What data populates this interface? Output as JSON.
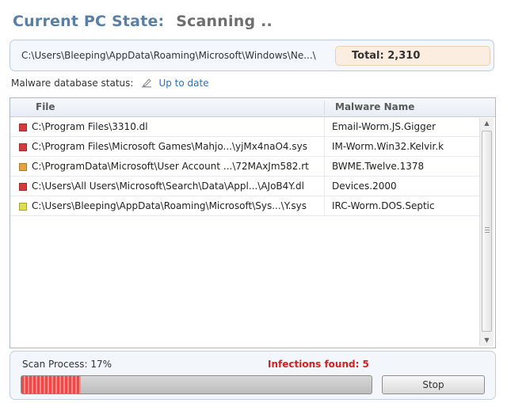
{
  "header": {
    "label": "Current PC State:",
    "state": "Scanning .."
  },
  "scan_path": {
    "current": "C:\\Users\\Bleeping\\AppData\\Roaming\\Microsoft\\Windows\\Ne...\\",
    "total": "Total: 2,310"
  },
  "database": {
    "label": "Malware database status:",
    "status": "Up to date",
    "icon": "edit-pencil-icon"
  },
  "table": {
    "columns": [
      "File",
      "Malware Name"
    ],
    "rows": [
      {
        "file": "C:\\Program Files\\3310.dl",
        "malware": "Email-Worm.JS.Gigger",
        "color": "#d63a3a"
      },
      {
        "file": "C:\\Program Files\\Microsoft Games\\Mahjo...\\yjMx4naO4.sys",
        "malware": "IM-Worm.Win32.Kelvir.k",
        "color": "#d63a3a"
      },
      {
        "file": "C:\\ProgramData\\Microsoft\\User Account ...\\72MAxJm582.rt",
        "malware": "BWME.Twelve.1378",
        "color": "#e8a23c"
      },
      {
        "file": "C:\\Users\\All Users\\Microsoft\\Search\\Data\\Appl...\\AJoB4Y.dl",
        "malware": "Devices.2000",
        "color": "#d63a3a"
      },
      {
        "file": "C:\\Users\\Bleeping\\AppData\\Roaming\\Microsoft\\Sys...\\Y.sys",
        "malware": "IRC-Worm.DOS.Septic",
        "color": "#dede4a"
      }
    ]
  },
  "footer": {
    "scan_label": "Scan Process: 17%",
    "progress": 0.17,
    "infections": "Infections found: 5",
    "stop_label": "Stop"
  }
}
